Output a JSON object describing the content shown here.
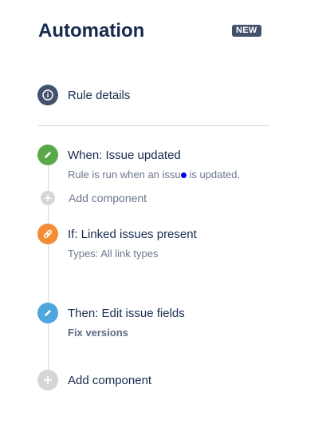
{
  "header": {
    "title": "Automation",
    "badge": "NEW"
  },
  "rule_details": {
    "label": "Rule details",
    "icon": "info-icon"
  },
  "colors": {
    "trigger": "#5aa849",
    "condition": "#f18d34",
    "action": "#4ea6dc",
    "details": "#42526e",
    "add": "#c9cbcf"
  },
  "steps": [
    {
      "type": "trigger",
      "label": "When: Issue updated",
      "description": "Rule is run when an issue is updated.",
      "icon": "pencil-icon"
    },
    {
      "type": "add",
      "label": "Add component",
      "icon": "plus-icon"
    },
    {
      "type": "condition",
      "label": "If: Linked issues present",
      "description": "Types: All link types",
      "icon": "link-icon"
    },
    {
      "type": "action",
      "label": "Then: Edit issue fields",
      "description": "Fix versions",
      "icon": "pencil-icon"
    },
    {
      "type": "add",
      "label": "Add component",
      "icon": "plus-icon"
    }
  ]
}
